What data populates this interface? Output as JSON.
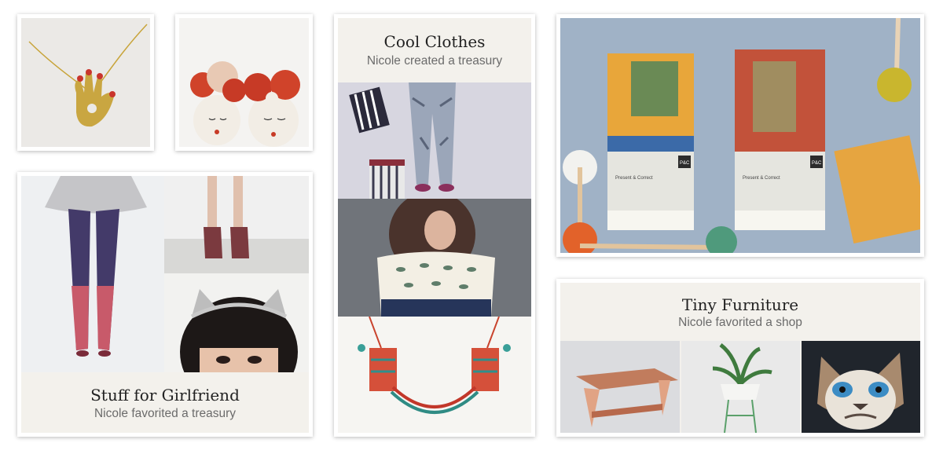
{
  "cards": {
    "cool_clothes": {
      "title": "Cool Clothes",
      "subtitle": "Nicole created a treasury"
    },
    "stuff_for_girlfriend": {
      "title": "Stuff for Girlfriend",
      "subtitle": "Nicole favorited a treasury"
    },
    "tiny_furniture": {
      "title": "Tiny Furniture",
      "subtitle": "Nicole favorited a shop"
    }
  },
  "postcards": {
    "brand": "P&C",
    "label": "Present & Correct"
  },
  "colors": {
    "card_bg": "#f3f1ec",
    "title_text": "#222222",
    "subtitle_text": "#6b6b6b"
  }
}
